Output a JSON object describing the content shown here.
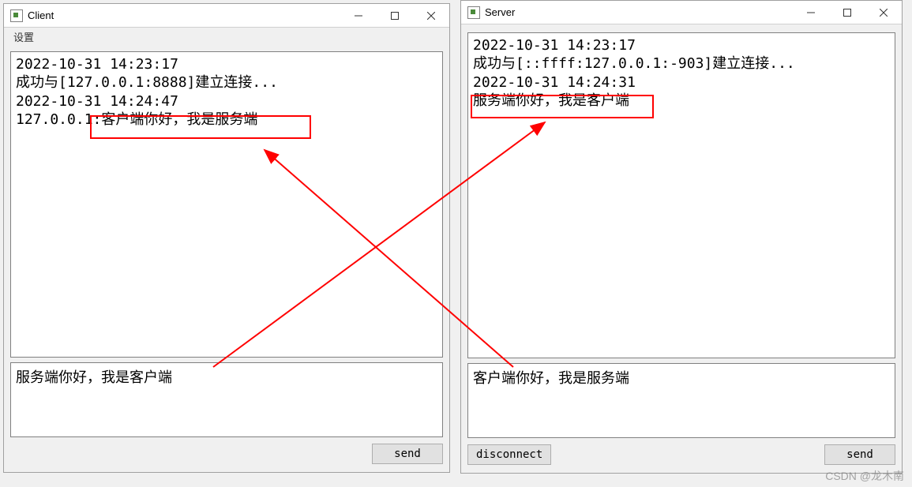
{
  "client": {
    "title": "Client",
    "menu": {
      "settings": "设置"
    },
    "log_lines": [
      "2022-10-31 14:23:17",
      "成功与[127.0.0.1:8888]建立连接...",
      "2022-10-31 14:24:47",
      "127.0.0.1:客户端你好，我是服务端"
    ],
    "input_value": "服务端你好，我是客户端",
    "send_label": "send"
  },
  "server": {
    "title": "Server",
    "log_lines": [
      "2022-10-31 14:23:17",
      "成功与[::ffff:127.0.0.1:-903]建立连接...",
      "2022-10-31 14:24:31",
      "服务端你好，我是客户端"
    ],
    "input_value": "客户端你好，我是服务端",
    "disconnect_label": "disconnect",
    "send_label": "send"
  },
  "watermark": "CSDN @龙木南",
  "annotations": {
    "client_highlight_text": "客户端你好，我是服务端",
    "server_highlight_text": "服务端你好，我是客户端"
  }
}
